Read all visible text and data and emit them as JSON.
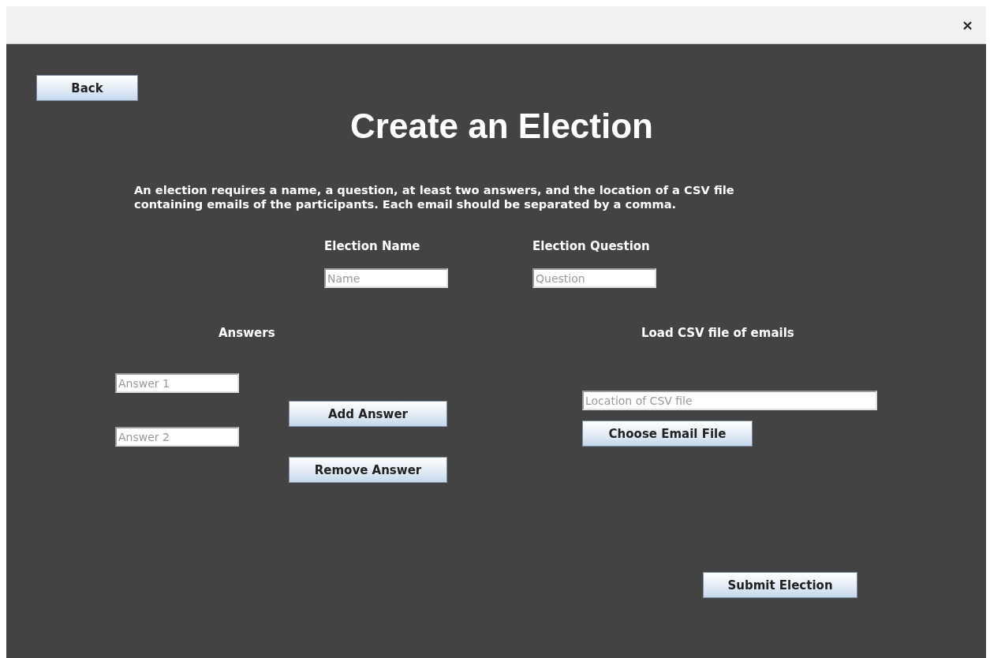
{
  "window": {
    "close_label": "×"
  },
  "back_button": "Back",
  "title": "Create an Election",
  "description": [
    "An election requires a name, a question, at least two answers, and the location of a CSV file",
    "containing emails of the participants. Each email should be separated by a comma."
  ],
  "fields": [
    {
      "label": "Election Name",
      "placeholder": "Name"
    },
    {
      "label": "Election Question",
      "placeholder": "Question"
    }
  ],
  "answers": {
    "label": "Answers",
    "fields": [
      {
        "placeholder": "Answer 1"
      },
      {
        "placeholder": "Answer 2"
      }
    ],
    "buttons": [
      "Add Answer",
      "Remove Answer"
    ]
  },
  "csv": {
    "label": "Load CSV file of emails",
    "placeholder": "Location of CSV file",
    "button": "Choose Email File"
  },
  "submit_button": "Submit Election"
}
